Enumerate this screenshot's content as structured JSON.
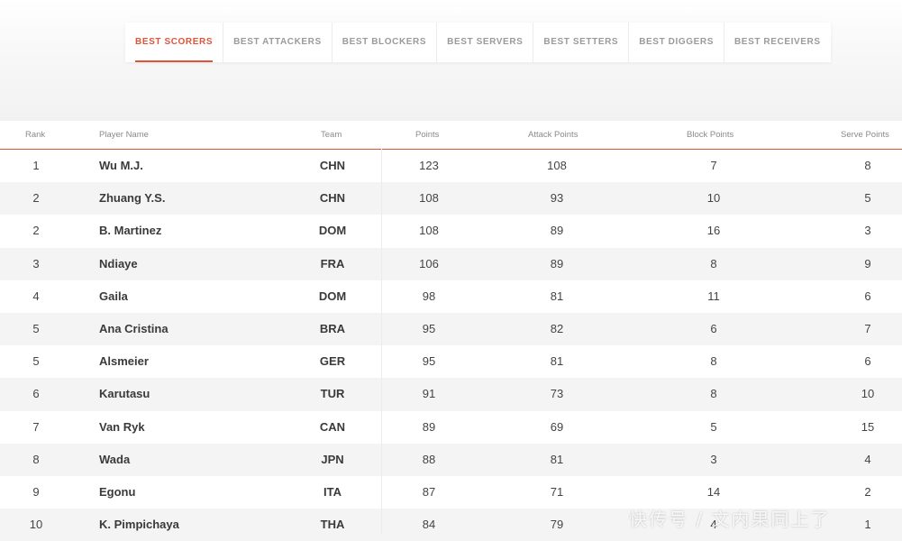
{
  "tabs": [
    {
      "label": "BEST SCORERS",
      "active": true
    },
    {
      "label": "BEST ATTACKERS",
      "active": false
    },
    {
      "label": "BEST BLOCKERS",
      "active": false
    },
    {
      "label": "BEST SERVERS",
      "active": false
    },
    {
      "label": "BEST SETTERS",
      "active": false
    },
    {
      "label": "BEST DIGGERS",
      "active": false
    },
    {
      "label": "BEST RECEIVERS",
      "active": false
    }
  ],
  "table": {
    "headers": {
      "rank": "Rank",
      "player": "Player Name",
      "team": "Team",
      "points": "Points",
      "attack": "Attack Points",
      "block": "Block Points",
      "serve": "Serve Points"
    },
    "rows": [
      {
        "rank": "1",
        "player": "Wu M.J.",
        "team": "CHN",
        "points": "123",
        "attack": "108",
        "block": "7",
        "serve": "8"
      },
      {
        "rank": "2",
        "player": "Zhuang Y.S.",
        "team": "CHN",
        "points": "108",
        "attack": "93",
        "block": "10",
        "serve": "5"
      },
      {
        "rank": "2",
        "player": "B. Martinez",
        "team": "DOM",
        "points": "108",
        "attack": "89",
        "block": "16",
        "serve": "3"
      },
      {
        "rank": "3",
        "player": "Ndiaye",
        "team": "FRA",
        "points": "106",
        "attack": "89",
        "block": "8",
        "serve": "9"
      },
      {
        "rank": "4",
        "player": "Gaila",
        "team": "DOM",
        "points": "98",
        "attack": "81",
        "block": "11",
        "serve": "6"
      },
      {
        "rank": "5",
        "player": "Ana Cristina",
        "team": "BRA",
        "points": "95",
        "attack": "82",
        "block": "6",
        "serve": "7"
      },
      {
        "rank": "5",
        "player": "Alsmeier",
        "team": "GER",
        "points": "95",
        "attack": "81",
        "block": "8",
        "serve": "6"
      },
      {
        "rank": "6",
        "player": "Karutasu",
        "team": "TUR",
        "points": "91",
        "attack": "73",
        "block": "8",
        "serve": "10"
      },
      {
        "rank": "7",
        "player": "Van Ryk",
        "team": "CAN",
        "points": "89",
        "attack": "69",
        "block": "5",
        "serve": "15"
      },
      {
        "rank": "8",
        "player": "Wada",
        "team": "JPN",
        "points": "88",
        "attack": "81",
        "block": "3",
        "serve": "4"
      },
      {
        "rank": "9",
        "player": "Egonu",
        "team": "ITA",
        "points": "87",
        "attack": "71",
        "block": "14",
        "serve": "2"
      },
      {
        "rank": "10",
        "player": "K. Pimpichaya",
        "team": "THA",
        "points": "84",
        "attack": "79",
        "block": "4",
        "serve": "1"
      }
    ]
  },
  "watermark": "快传号 / 文内果同上了",
  "colors": {
    "accent": "#e0533b"
  }
}
